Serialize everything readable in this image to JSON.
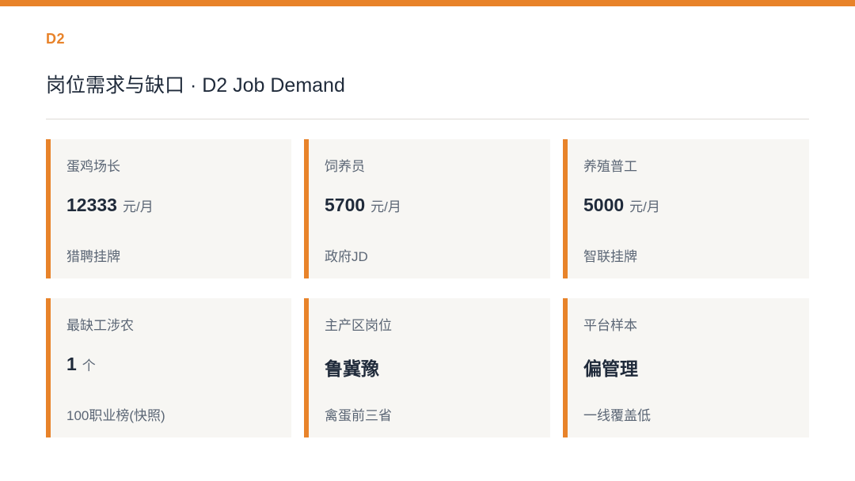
{
  "theme": {
    "accent": "#E8832A",
    "text_primary": "#1F2A3A",
    "text_secondary": "#5B6675",
    "card_bg": "#F7F6F3"
  },
  "header": {
    "tag": "D2",
    "title": "岗位需求与缺口 · D2 Job Demand"
  },
  "cards": [
    {
      "label": "蛋鸡场长",
      "value": "12333",
      "unit": "元/月",
      "source": "猎聘挂牌"
    },
    {
      "label": "饲养员",
      "value": "5700",
      "unit": "元/月",
      "source": "政府JD"
    },
    {
      "label": "养殖普工",
      "value": "5000",
      "unit": "元/月",
      "source": "智联挂牌"
    },
    {
      "label": "最缺工涉农",
      "value": "1",
      "unit": "个",
      "source": "100职业榜(快照)"
    },
    {
      "label": "主产区岗位",
      "value": "鲁冀豫",
      "unit": "",
      "source": "禽蛋前三省"
    },
    {
      "label": "平台样本",
      "value": "偏管理",
      "unit": "",
      "source": "一线覆盖低"
    }
  ]
}
